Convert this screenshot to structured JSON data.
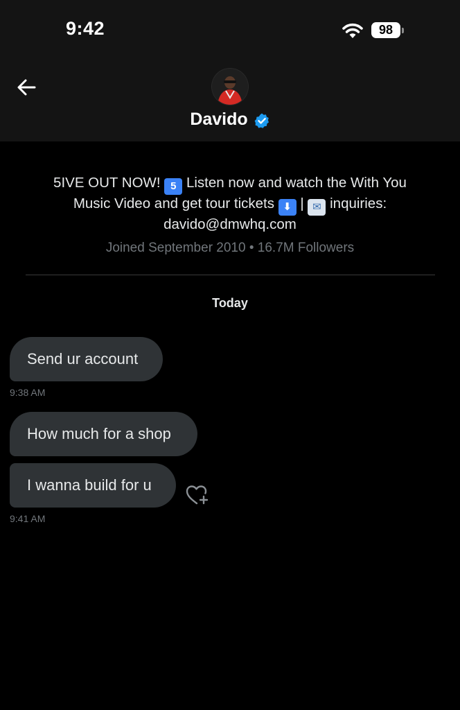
{
  "status_bar": {
    "time": "9:42",
    "battery": "98"
  },
  "header": {
    "back_icon": "arrow-left-icon",
    "name": "Davido",
    "verified_icon": "verified-badge-icon"
  },
  "profile": {
    "bio_line1_a": "5IVE OUT NOW! ",
    "bio_emoji_5": "5",
    "bio_line1_b": " Listen now and watch the With You",
    "bio_line2_a": "Music Video and get tour tickets ",
    "bio_emoji_down": "⬇",
    "bio_line2_b": " | ",
    "bio_emoji_mail": "✉",
    "bio_line2_c": " inquiries:",
    "bio_line3": "davido@dmwhq.com",
    "meta": "Joined September 2010 • 16.7M Followers"
  },
  "conversation": {
    "day_label": "Today",
    "messages": [
      {
        "text": "Send ur account",
        "time": "9:38 AM"
      },
      {
        "text": "How much for a shop"
      },
      {
        "text": "I wanna build for u",
        "time": "9:41 AM"
      }
    ],
    "react_icon": "heart-plus-icon"
  },
  "colors": {
    "background": "#000000",
    "header_bg": "#141414",
    "bubble": "#2f3336",
    "verified": "#1d9bf0",
    "muted_text": "#71767b"
  }
}
